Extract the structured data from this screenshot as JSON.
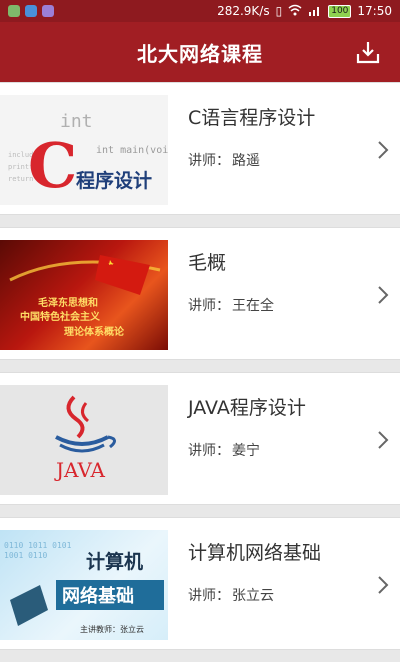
{
  "status": {
    "speed": "282.9K/s",
    "battery": "100",
    "time": "17:50"
  },
  "header": {
    "title": "北大网络课程",
    "download_icon": "download-icon"
  },
  "courses": [
    {
      "name": "C语言程序设计",
      "teacher_label": "讲师：",
      "teacher": "路遥",
      "thumb_text": "程序设计",
      "thumb_code": "int main(void)"
    },
    {
      "name": "毛概",
      "teacher_label": "讲师：",
      "teacher": "王在全",
      "thumb_lines": [
        "毛泽东思想和",
        "中国特色社会主义",
        "理论体系概论"
      ]
    },
    {
      "name": "JAVA程序设计",
      "teacher_label": "讲师：",
      "teacher": "姜宁",
      "thumb_text": "JAVA"
    },
    {
      "name": "计算机网络基础",
      "teacher_label": "讲师：",
      "teacher": "张立云",
      "thumb_line1": "计算机",
      "thumb_line2": "网络基础",
      "thumb_caption": "主讲教师：张立云"
    }
  ],
  "colors": {
    "primary": "#a11e23",
    "statusbar": "#8e1a1f"
  }
}
